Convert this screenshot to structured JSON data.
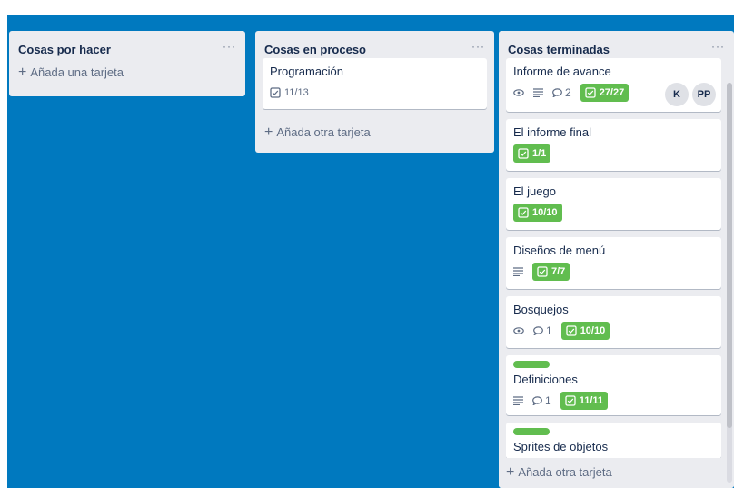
{
  "colors": {
    "board_background": "#0079bf",
    "list_background": "#ebecf0",
    "label_green": "#61bd4f",
    "text_dark": "#172b4d",
    "text_muted": "#5e6c84"
  },
  "lists": [
    {
      "title": "Cosas por hacer",
      "menu": "···",
      "add_label": "Añada una tarjeta",
      "cards": []
    },
    {
      "title": "Cosas en proceso",
      "menu": "···",
      "add_label": "Añada otra tarjeta",
      "cards": [
        {
          "title": "Programación",
          "checklist": "11/13",
          "checklist_complete": false
        }
      ]
    },
    {
      "title": "Cosas terminadas",
      "menu": "···",
      "add_label": "Añada otra tarjeta",
      "cards": [
        {
          "title": "Informe de avance",
          "watch": true,
          "description": true,
          "comments": "2",
          "checklist": "27/27",
          "members": [
            "K",
            "PP"
          ]
        },
        {
          "title": "El informe final",
          "checklist": "1/1"
        },
        {
          "title": "El juego",
          "checklist": "10/10"
        },
        {
          "title": "Diseños de menú",
          "description": true,
          "checklist": "7/7"
        },
        {
          "title": "Bosquejos",
          "watch": true,
          "comments": "1",
          "checklist": "10/10"
        },
        {
          "title": "Definiciones",
          "label": "green",
          "description": true,
          "comments": "1",
          "checklist": "11/11"
        },
        {
          "title": "Sprites de objetos",
          "label": "green"
        }
      ]
    }
  ],
  "icons": {
    "plus": "+",
    "watch": "eye-icon",
    "description": "description-icon",
    "comment": "comment-icon",
    "checklist": "checklist-icon"
  }
}
